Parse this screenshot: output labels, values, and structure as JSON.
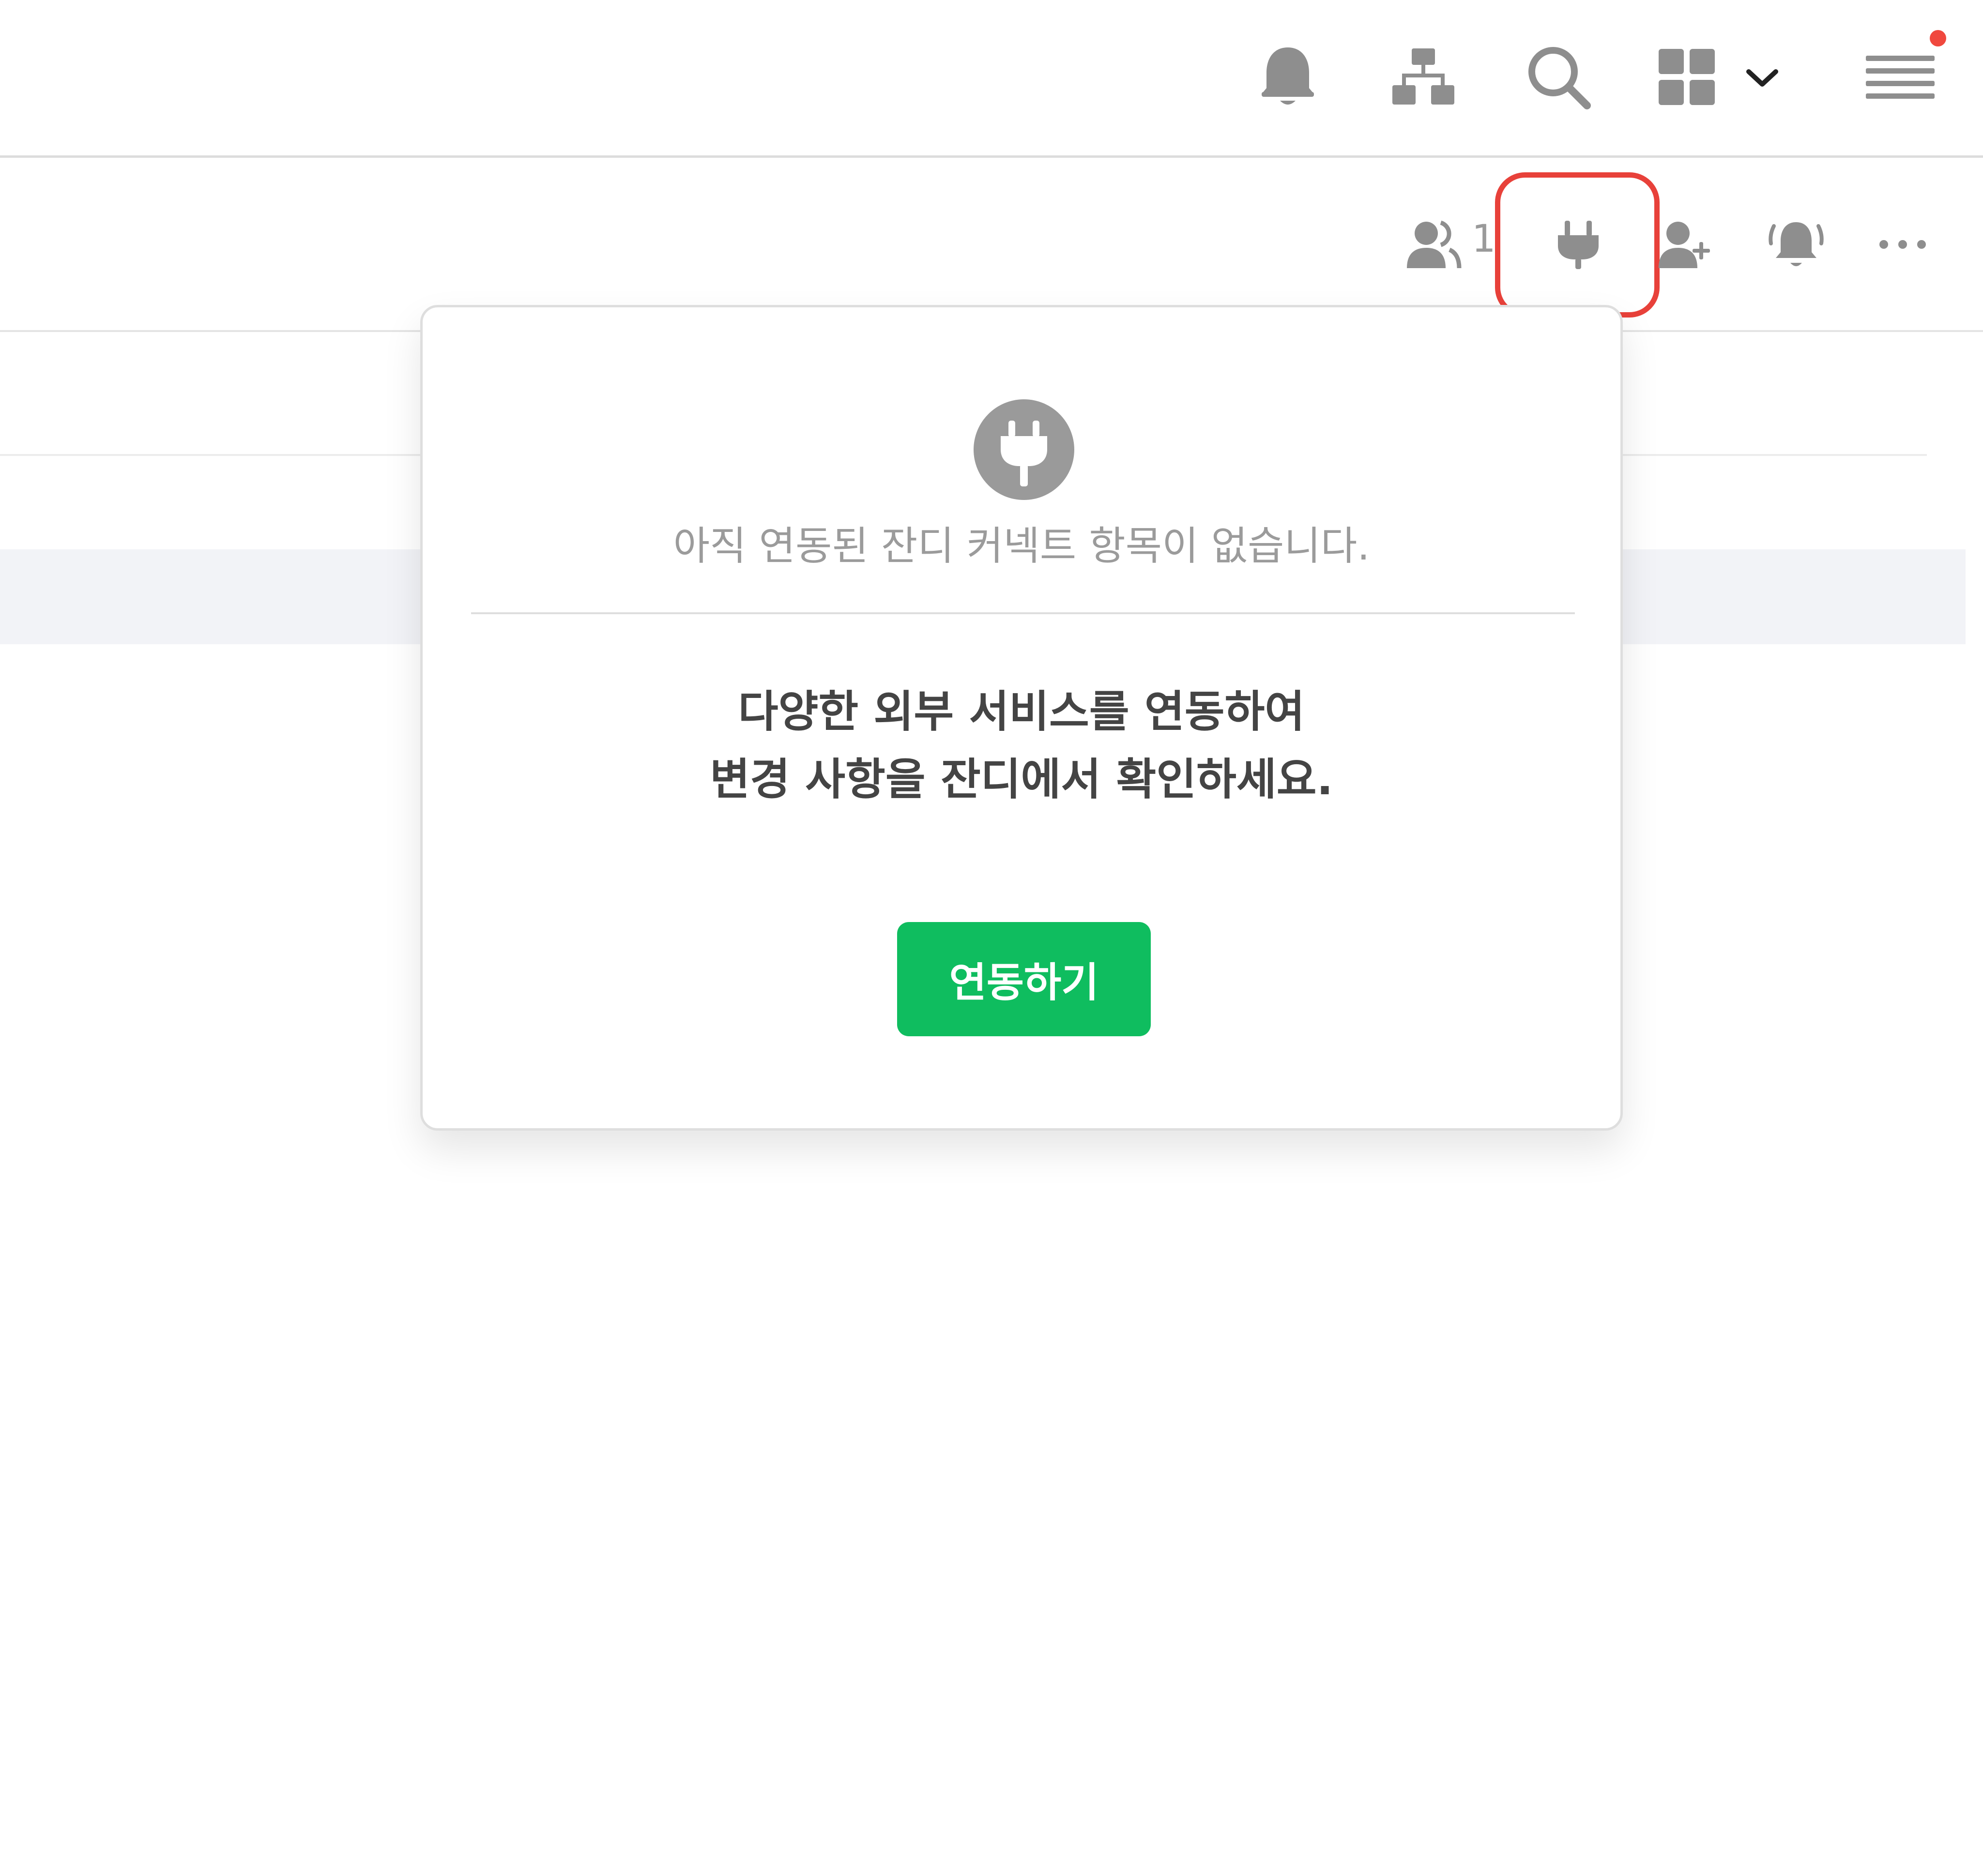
{
  "colors": {
    "accent_green": "#0fbd5f",
    "notification_red": "#f0483e",
    "highlight_red": "#e8413a",
    "icon_gray": "#9a9a9a",
    "icon_dark": "#8e8e8e"
  },
  "header": {
    "icons": [
      "bell-icon",
      "org-chart-icon",
      "search-icon",
      "apps-grid-icon",
      "chevron-down-icon",
      "menu-icon"
    ]
  },
  "channel_toolbar": {
    "member_count": "1",
    "icons": [
      "members-icon",
      "plug-icon",
      "invite-member-icon",
      "channel-alarm-icon",
      "more-icon"
    ]
  },
  "connect_popover": {
    "icon": "plug-icon",
    "empty_message": "아직 연동된 잔디 커넥트 항목이 없습니다.",
    "description_line1": "다양한 외부 서비스를 연동하여",
    "description_line2": "변경 사항을 잔디에서 확인하세요.",
    "connect_button_label": "연동하기"
  }
}
